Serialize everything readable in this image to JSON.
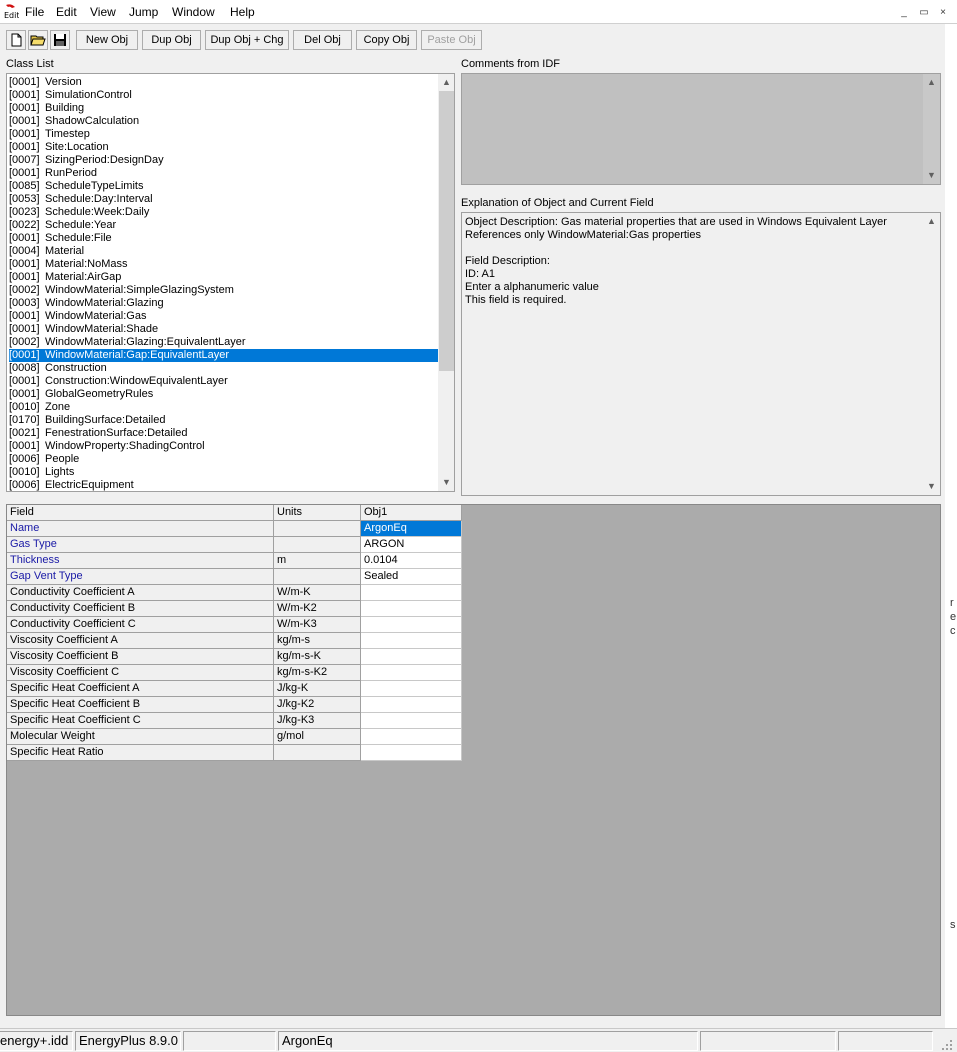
{
  "menu": {
    "items": [
      "File",
      "Edit",
      "View",
      "Jump",
      "Window",
      "Help"
    ],
    "mdi_controls": [
      "_",
      "▭",
      "×"
    ]
  },
  "toolbar": {
    "new_obj": "New Obj",
    "dup_obj": "Dup Obj",
    "dup_obj_chg": "Dup Obj + Chg",
    "del_obj": "Del Obj",
    "copy_obj": "Copy Obj",
    "paste_obj": "Paste Obj"
  },
  "labels": {
    "class_list": "Class List",
    "comments": "Comments from IDF",
    "explanation": "Explanation of Object and Current Field"
  },
  "class_list": {
    "selected_index": 21,
    "items": [
      {
        "count": "[0001]",
        "name": "Version"
      },
      {
        "count": "[0001]",
        "name": "SimulationControl"
      },
      {
        "count": "[0001]",
        "name": "Building"
      },
      {
        "count": "[0001]",
        "name": "ShadowCalculation"
      },
      {
        "count": "[0001]",
        "name": "Timestep"
      },
      {
        "count": "[0001]",
        "name": "Site:Location"
      },
      {
        "count": "[0007]",
        "name": "SizingPeriod:DesignDay"
      },
      {
        "count": "[0001]",
        "name": "RunPeriod"
      },
      {
        "count": "[0085]",
        "name": "ScheduleTypeLimits"
      },
      {
        "count": "[0053]",
        "name": "Schedule:Day:Interval"
      },
      {
        "count": "[0023]",
        "name": "Schedule:Week:Daily"
      },
      {
        "count": "[0022]",
        "name": "Schedule:Year"
      },
      {
        "count": "[0001]",
        "name": "Schedule:File"
      },
      {
        "count": "[0004]",
        "name": "Material"
      },
      {
        "count": "[0001]",
        "name": "Material:NoMass"
      },
      {
        "count": "[0001]",
        "name": "Material:AirGap"
      },
      {
        "count": "[0002]",
        "name": "WindowMaterial:SimpleGlazingSystem"
      },
      {
        "count": "[0003]",
        "name": "WindowMaterial:Glazing"
      },
      {
        "count": "[0001]",
        "name": "WindowMaterial:Gas"
      },
      {
        "count": "[0001]",
        "name": "WindowMaterial:Shade"
      },
      {
        "count": "[0002]",
        "name": "WindowMaterial:Glazing:EquivalentLayer"
      },
      {
        "count": "[0001]",
        "name": "WindowMaterial:Gap:EquivalentLayer"
      },
      {
        "count": "[0008]",
        "name": "Construction"
      },
      {
        "count": "[0001]",
        "name": "Construction:WindowEquivalentLayer"
      },
      {
        "count": "[0001]",
        "name": "GlobalGeometryRules"
      },
      {
        "count": "[0010]",
        "name": "Zone"
      },
      {
        "count": "[0170]",
        "name": "BuildingSurface:Detailed"
      },
      {
        "count": "[0021]",
        "name": "FenestrationSurface:Detailed"
      },
      {
        "count": "[0001]",
        "name": "WindowProperty:ShadingControl"
      },
      {
        "count": "[0006]",
        "name": "People"
      },
      {
        "count": "[0010]",
        "name": "Lights"
      },
      {
        "count": "[0006]",
        "name": "ElectricEquipment"
      }
    ]
  },
  "explanation": {
    "lines": [
      "Object Description: Gas material properties that are used in Windows Equivalent Layer",
      "References only WindowMaterial:Gas properties",
      "",
      "Field Description:",
      "ID: A1",
      "Enter a alphanumeric value",
      "This field is required."
    ]
  },
  "grid": {
    "headers": {
      "field": "Field",
      "units": "Units",
      "obj": "Obj1"
    },
    "rows": [
      {
        "field": "Name",
        "units": "",
        "value": "ArgonEq",
        "required": true,
        "selected": true
      },
      {
        "field": "Gas Type",
        "units": "",
        "value": "ARGON",
        "required": true
      },
      {
        "field": "Thickness",
        "units": "m",
        "value": "0.0104",
        "required": true
      },
      {
        "field": "Gap Vent Type",
        "units": "",
        "value": "Sealed",
        "required": true
      },
      {
        "field": "Conductivity Coefficient A",
        "units": "W/m-K",
        "value": ""
      },
      {
        "field": "Conductivity Coefficient B",
        "units": "W/m-K2",
        "value": ""
      },
      {
        "field": "Conductivity Coefficient C",
        "units": "W/m-K3",
        "value": ""
      },
      {
        "field": "Viscosity Coefficient A",
        "units": "kg/m-s",
        "value": ""
      },
      {
        "field": "Viscosity Coefficient B",
        "units": "kg/m-s-K",
        "value": ""
      },
      {
        "field": "Viscosity Coefficient C",
        "units": "kg/m-s-K2",
        "value": ""
      },
      {
        "field": "Specific Heat Coefficient A",
        "units": "J/kg-K",
        "value": ""
      },
      {
        "field": "Specific Heat Coefficient B",
        "units": "J/kg-K2",
        "value": ""
      },
      {
        "field": "Specific Heat Coefficient C",
        "units": "J/kg-K3",
        "value": ""
      },
      {
        "field": "Molecular Weight",
        "units": "g/mol",
        "value": ""
      },
      {
        "field": "Specific Heat Ratio",
        "units": "",
        "value": ""
      }
    ]
  },
  "status": {
    "idd": "energy+.idd",
    "version": "EnergyPlus 8.9.0",
    "pane3": "",
    "current": "ArgonEq",
    "pane5": "",
    "pane6": ""
  },
  "right_strip_chars": [
    "r",
    "e",
    "c",
    "s"
  ],
  "colors": {
    "selection": "#0078d7",
    "required_field": "#1a1aa6",
    "grid_background": "#ababab"
  }
}
